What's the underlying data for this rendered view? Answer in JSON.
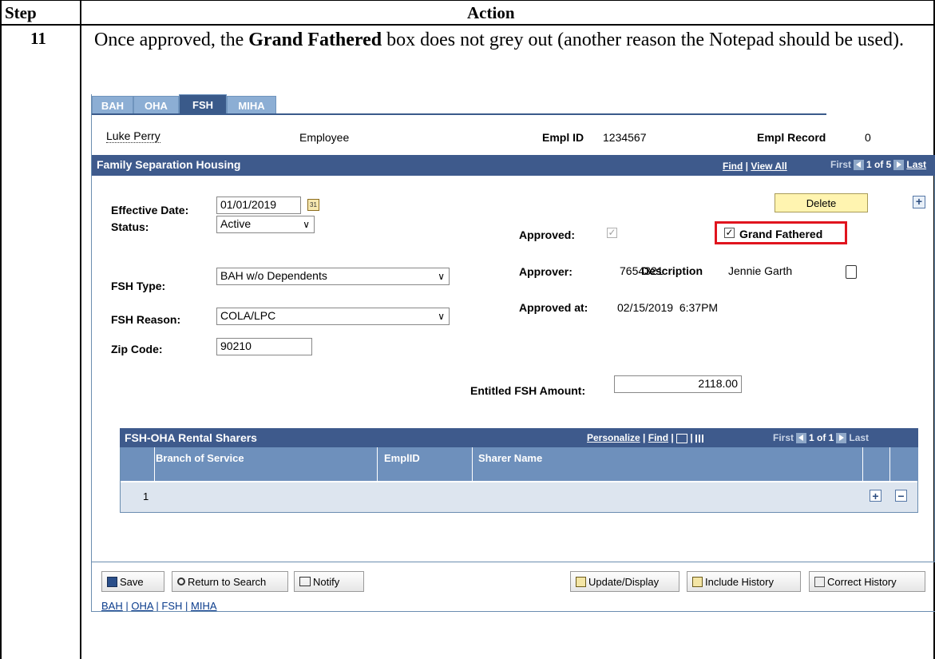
{
  "doc": {
    "col_step": "Step",
    "col_action": "Action",
    "step_number": "11",
    "text_before": "Once approved, the ",
    "text_bold": "Grand Fathered",
    "text_after": " box does not grey out (another reason the Notepad should be used)."
  },
  "tabs": [
    "BAH",
    "OHA",
    "FSH",
    "MIHA"
  ],
  "active_tab": "FSH",
  "header": {
    "name": "Luke Perry",
    "role": "Employee",
    "empl_id_label": "Empl ID",
    "empl_id": "1234567",
    "empl_record_label": "Empl Record",
    "empl_record": "0"
  },
  "section": {
    "title": "Family Separation Housing",
    "find": "Find",
    "view_all": "View All",
    "first": "First",
    "count": "1 of 5",
    "last": "Last"
  },
  "form": {
    "effective_date_label": "Effective Date:",
    "effective_date": "01/01/2019",
    "status_label": "Status:",
    "status": "Active",
    "fsh_type_label": "FSH Type:",
    "fsh_type": "BAH w/o Dependents",
    "fsh_reason_label": "FSH Reason:",
    "fsh_reason": "COLA/LPC",
    "zip_label": "Zip Code:",
    "zip": "90210",
    "approved_label": "Approved:",
    "grandfathered_label": "Grand Fathered",
    "approver_label": "Approver:",
    "approver_id": "7654321",
    "description_label": "Description",
    "approver_name": "Jennie Garth",
    "approved_at_label": "Approved at:",
    "approved_at": "02/15/2019  6:37PM",
    "entitled_label": "Entitled FSH Amount:",
    "entitled_amount": "2118.00",
    "delete_label": "Delete"
  },
  "sharers": {
    "title": "FSH-OHA Rental Sharers",
    "personalize": "Personalize",
    "find": "Find",
    "first": "First",
    "count": "1 of 1",
    "last": "Last",
    "columns": [
      "Branch of Service",
      "EmplID",
      "Sharer Name"
    ],
    "row_number": "1"
  },
  "toolbar": {
    "save": "Save",
    "return_to_search": "Return to Search",
    "notify": "Notify",
    "update_display": "Update/Display",
    "include_history": "Include History",
    "correct_history": "Correct History"
  },
  "footer_links": [
    "BAH",
    "OHA",
    "FSH",
    "MIHA"
  ],
  "colors": {
    "header_bar": "#3e5a8c",
    "tab_active": "#3a5a8a",
    "highlight_box": "#e0141e",
    "delete_button": "#fff4b0"
  }
}
